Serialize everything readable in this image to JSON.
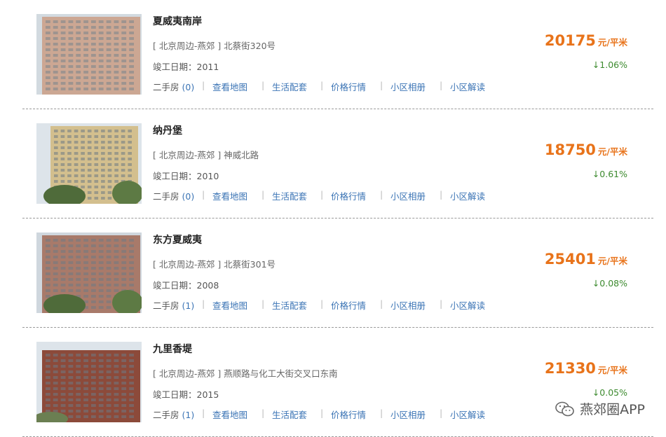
{
  "listings": [
    {
      "name": "夏威夷南岸",
      "address": "[ 北京周边-燕郊 ] 北蔡街320号",
      "built_label": "竣工日期：",
      "built_year": "2011",
      "secondhand_label": "二手房",
      "secondhand_count": "(0)",
      "price": "20175",
      "price_unit": "元/平米",
      "change": "↓1.06%",
      "photo_color": "#c8a08a"
    },
    {
      "name": "纳丹堡",
      "address": "[ 北京周边-燕郊 ] 神威北路",
      "built_label": "竣工日期：",
      "built_year": "2010",
      "secondhand_label": "二手房",
      "secondhand_count": "(0)",
      "price": "18750",
      "price_unit": "元/平米",
      "change": "↓0.61%",
      "photo_color": "#d3bf8e"
    },
    {
      "name": "东方夏威夷",
      "address": "[ 北京周边-燕郊 ] 北蔡街301号",
      "built_label": "竣工日期：",
      "built_year": "2008",
      "secondhand_label": "二手房",
      "secondhand_count": "(1)",
      "price": "25401",
      "price_unit": "元/平米",
      "change": "↓0.08%",
      "photo_color": "#a87a6a"
    },
    {
      "name": "九里香堤",
      "address": "[ 北京周边-燕郊 ] 燕顺路与化工大街交叉口东南",
      "built_label": "竣工日期：",
      "built_year": "2015",
      "secondhand_label": "二手房",
      "secondhand_count": "(1)",
      "price": "21330",
      "price_unit": "元/平米",
      "change": "↓0.05%",
      "photo_color": "#8c4a3a"
    }
  ],
  "links": [
    "查看地图",
    "生活配套",
    "价格行情",
    "小区相册",
    "小区解读"
  ],
  "separator": "|",
  "watermark": {
    "text": "燕郊圈APP",
    "icon": "wechat-icon"
  },
  "colors": {
    "price": "#e8731a",
    "change_down": "#3c8a2e",
    "link": "#3b74b5"
  }
}
